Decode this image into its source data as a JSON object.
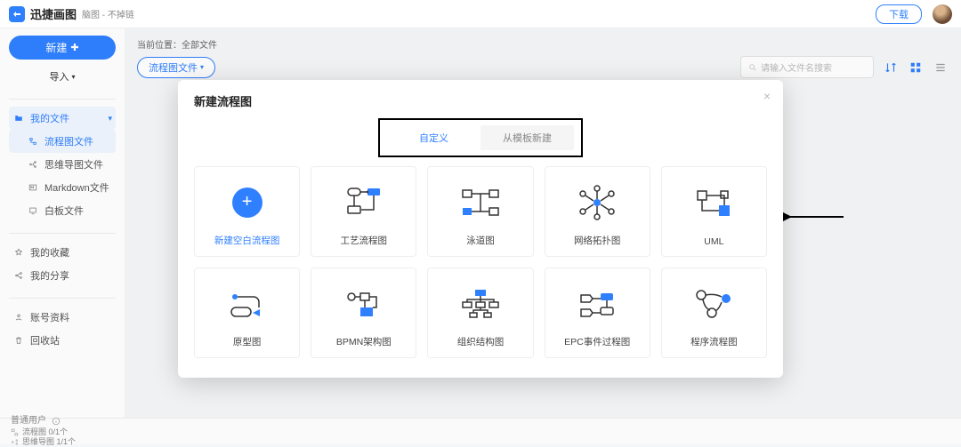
{
  "topbar": {
    "brand": "迅捷画图",
    "tagline": "脑图 - 不掉链",
    "download": "下载"
  },
  "sidebar": {
    "new_btn": "新建",
    "import_btn": "导入",
    "my_files": "我的文件",
    "children": [
      {
        "label": "流程图文件"
      },
      {
        "label": "思维导图文件"
      },
      {
        "label": "Markdown文件"
      },
      {
        "label": "白板文件"
      }
    ],
    "favorites": "我的收藏",
    "share": "我的分享",
    "account": "账号资料",
    "trash": "回收站"
  },
  "main": {
    "location_label": "当前位置：",
    "location_value": "全部文件",
    "filter_pill": "流程图文件",
    "search_placeholder": "请输入文件名搜索"
  },
  "statusbar": {
    "user_type": "普通用户",
    "flow_count": "流程图 0/1个",
    "mind_count": "思维导图 1/1个"
  },
  "modal": {
    "title": "新建流程图",
    "tab_custom": "自定义",
    "tab_template": "从模板新建",
    "cards": [
      {
        "label": "新建空白流程图",
        "kind": "blank"
      },
      {
        "label": "工艺流程图",
        "kind": "process"
      },
      {
        "label": "泳道图",
        "kind": "swimlane"
      },
      {
        "label": "网络拓扑图",
        "kind": "network"
      },
      {
        "label": "UML",
        "kind": "uml"
      },
      {
        "label": "原型图",
        "kind": "prototype"
      },
      {
        "label": "BPMN架构图",
        "kind": "bpmn"
      },
      {
        "label": "组织结构图",
        "kind": "org"
      },
      {
        "label": "EPC事件过程图",
        "kind": "epc"
      },
      {
        "label": "程序流程图",
        "kind": "program"
      }
    ]
  }
}
